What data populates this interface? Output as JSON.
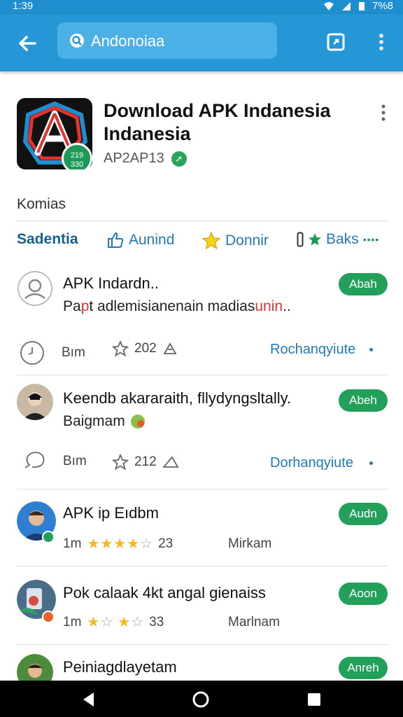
{
  "status": {
    "time": "1:39",
    "battery": "7%8"
  },
  "search": {
    "query": "Andonoiaa"
  },
  "app": {
    "title": "Download APK Indanesia Indanesia",
    "badge_text": "219 330",
    "developer": "AP2AP13"
  },
  "section": {
    "label": "Komias"
  },
  "tabs": [
    {
      "label": "Sadentia",
      "icon": "none"
    },
    {
      "label": "Aunind",
      "icon": "thumbs-up-icon"
    },
    {
      "label": "Donnir",
      "icon": "star-icon"
    },
    {
      "label": "Baks",
      "icon": "bookmark-icon",
      "extra": "••••"
    }
  ],
  "items": [
    {
      "title": "APK Indardn..",
      "subtitle_a": "Pa",
      "subtitle_red": "p",
      "subtitle_b": "t adlemisianenain madias",
      "subtitle_red2": "unin",
      "subtitle_c": "..",
      "meta_left": "Bım",
      "meta_count": "202",
      "link": "Rochanqyiute",
      "action": "Abah",
      "avatar": "person-outline-icon"
    },
    {
      "title": "Keendb akararaith, fllydyngsltally.",
      "subtitle": "Baigmam",
      "meta_left": "Bım",
      "meta_count": "212",
      "link": "Dorhanqyiute",
      "action": "Abeh",
      "avatar": "photo-avatar"
    },
    {
      "title": "APK ip Eıdbm",
      "meta_time": "1m",
      "rating": 4,
      "meta_count": "23",
      "meta_right": "Mirkam",
      "action": "Audn",
      "avatar": "photo-avatar"
    },
    {
      "title": "Pok calaak 4kt angal gienaiss",
      "meta_time": "1m",
      "rating": 2,
      "meta_count": "33",
      "meta_right": "Marlnam",
      "action": "Aoon",
      "avatar": "photo-avatar"
    },
    {
      "title": "Peiniagdlayetam",
      "action": "Anreh",
      "avatar": "photo-avatar"
    }
  ],
  "colors": {
    "primary": "#2597d7",
    "green": "#22a05a",
    "link": "#1f7ab8"
  }
}
